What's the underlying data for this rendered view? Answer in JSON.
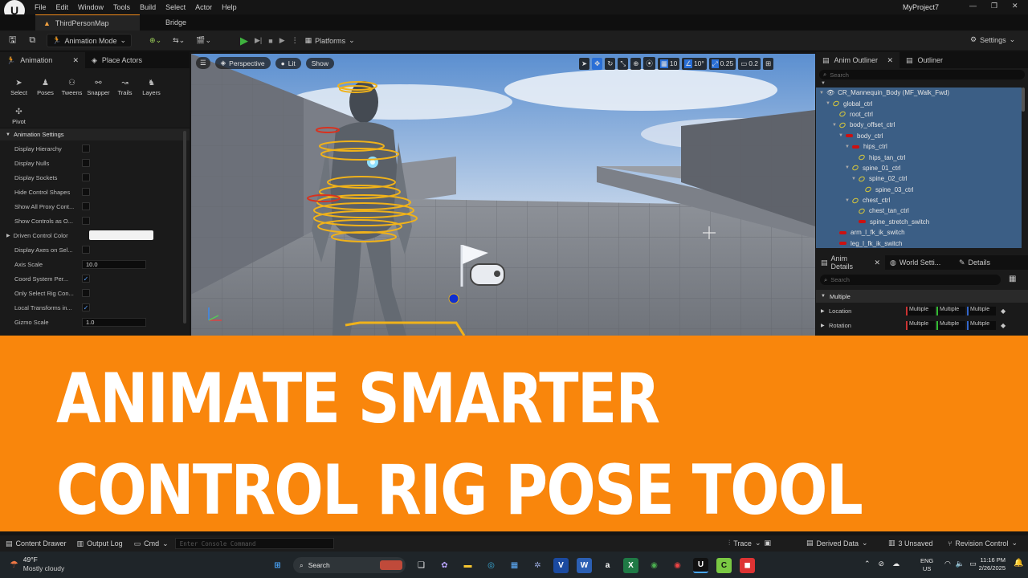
{
  "menu": {
    "items": [
      "File",
      "Edit",
      "Window",
      "Tools",
      "Build",
      "Select",
      "Actor",
      "Help"
    ],
    "project": "MyProject7",
    "window_controls": [
      "minimize-icon",
      "restore-icon",
      "close-icon"
    ]
  },
  "tabs": {
    "map": "ThirdPersonMap",
    "bridge": "Bridge"
  },
  "toolbar": {
    "mode": "Animation Mode",
    "platforms": "Platforms",
    "settings": "Settings"
  },
  "left_panel": {
    "tab_animation": "Animation",
    "tab_place_actors": "Place Actors",
    "tools": [
      "Select",
      "Poses",
      "Tweens",
      "Snapper",
      "Trails",
      "Layers",
      "Pivot"
    ],
    "section_title": "Animation Settings",
    "settings": [
      {
        "label": "Display Hierarchy",
        "type": "check",
        "checked": false
      },
      {
        "label": "Display Nulls",
        "type": "check",
        "checked": false
      },
      {
        "label": "Display Sockets",
        "type": "check",
        "checked": false
      },
      {
        "label": "Hide Control Shapes",
        "type": "check",
        "checked": false
      },
      {
        "label": "Show All Proxy Cont...",
        "type": "check",
        "checked": false
      },
      {
        "label": "Show Controls as O...",
        "type": "check",
        "checked": false
      },
      {
        "label": "Driven Control Color",
        "type": "color",
        "value": "#f2f2f2"
      },
      {
        "label": "Display Axes on Sel...",
        "type": "check",
        "checked": false
      },
      {
        "label": "Axis Scale",
        "type": "number",
        "value": "10.0"
      },
      {
        "label": "Coord System Per...",
        "type": "check",
        "checked": true
      },
      {
        "label": "Only Select Rig Con...",
        "type": "check",
        "checked": false
      },
      {
        "label": "Local Transforms in...",
        "type": "check",
        "checked": true
      },
      {
        "label": "Gizmo Scale",
        "type": "number",
        "value": "1.0"
      }
    ]
  },
  "viewport": {
    "perspective": "Perspective",
    "lit": "Lit",
    "show": "Show",
    "grid_snap": "10",
    "rot_snap": "10°",
    "scale_snap": "0.25",
    "camera_speed": "0.2"
  },
  "outliner": {
    "tab_anim_outliner": "Anim Outliner",
    "tab_outliner": "Outliner",
    "search_placeholder": "Search",
    "root": "CR_Mannequin_Body  (MF_Walk_Fwd)",
    "nodes": [
      {
        "label": "global_ctrl",
        "indent": 1,
        "arrow": true,
        "kind": "ctrl"
      },
      {
        "label": "root_ctrl",
        "indent": 2,
        "arrow": false,
        "kind": "ctrl"
      },
      {
        "label": "body_offset_ctrl",
        "indent": 2,
        "arrow": true,
        "kind": "ctrl"
      },
      {
        "label": "body_ctrl",
        "indent": 3,
        "arrow": true,
        "kind": "red"
      },
      {
        "label": "hips_ctrl",
        "indent": 4,
        "arrow": true,
        "kind": "red"
      },
      {
        "label": "hips_tan_ctrl",
        "indent": 5,
        "arrow": false,
        "kind": "ctrl"
      },
      {
        "label": "spine_01_ctrl",
        "indent": 4,
        "arrow": true,
        "kind": "ctrl"
      },
      {
        "label": "spine_02_ctrl",
        "indent": 5,
        "arrow": true,
        "kind": "ctrl"
      },
      {
        "label": "spine_03_ctrl",
        "indent": 6,
        "arrow": false,
        "kind": "ctrl"
      },
      {
        "label": "chest_ctrl",
        "indent": 4,
        "arrow": true,
        "kind": "ctrl"
      },
      {
        "label": "chest_tan_ctrl",
        "indent": 5,
        "arrow": false,
        "kind": "ctrl"
      },
      {
        "label": "spine_stretch_switch",
        "indent": 5,
        "arrow": false,
        "kind": "red"
      },
      {
        "label": "arm_l_fk_ik_switch",
        "indent": 2,
        "arrow": false,
        "kind": "red"
      },
      {
        "label": "leg_l_fk_ik_switch",
        "indent": 2,
        "arrow": false,
        "kind": "red"
      }
    ]
  },
  "details": {
    "tab_anim_details": "Anim Details",
    "tab_world_settings": "World Setti...",
    "tab_details": "Details",
    "search_placeholder": "Search",
    "section": "Multiple",
    "location_label": "Location",
    "rotation_label": "Rotation",
    "multiple_value": "Multiple"
  },
  "banner": {
    "line1": "ANIMATE SMARTER",
    "line2": "CONTROL RIG POSE TOOL"
  },
  "statusbar": {
    "content_drawer": "Content Drawer",
    "output_log": "Output Log",
    "cmd": "Cmd",
    "console_placeholder": "Enter Console Command",
    "trace": "Trace",
    "derived_data": "Derived Data",
    "unsaved": "3 Unsaved",
    "revision_control": "Revision Control"
  },
  "taskbar": {
    "temperature": "49°F",
    "weather": "Mostly cloudy",
    "search": "Search",
    "lang": "ENG",
    "region": "US",
    "time": "11:16 PM",
    "date": "2/26/2025"
  },
  "colors": {
    "banner": "#f9860c",
    "selection": "#3b5e85",
    "accent_blue": "#2a6fd6",
    "play_green": "#3fb23f"
  }
}
